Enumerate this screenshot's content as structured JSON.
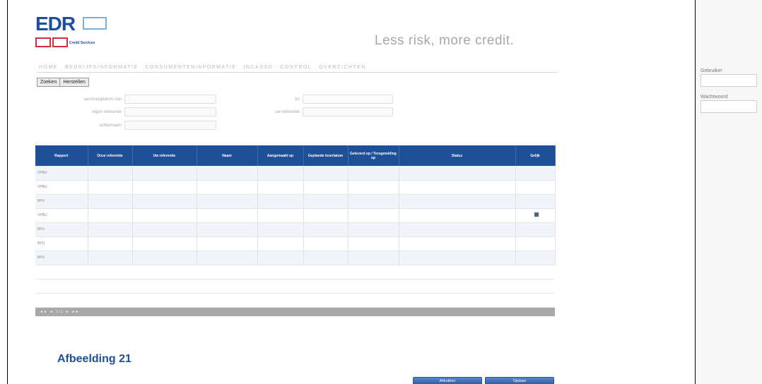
{
  "logo": {
    "text": "EDR",
    "subtitle": "Credit Services"
  },
  "tagline": "Less risk, more credit.",
  "nav": [
    "HOME",
    "BEDRIJFSINFORMATIE",
    "CONSUMENTENINFORMATIE",
    "INCASSO",
    "CONTROL",
    "OVERZICHTEN"
  ],
  "buttons": {
    "search": "Zoeken",
    "reset": "Herstellen"
  },
  "filters": {
    "left": [
      "aanvraagdatum van",
      "eigen referentie",
      "achternaam"
    ],
    "right": [
      "tot",
      "uw referentie"
    ]
  },
  "table": {
    "headers": [
      "Rapport",
      "Onze referentie",
      "Uw referentie",
      "Naam",
      "Aangemaakt op",
      "Geplande levertatum",
      "Geleverd op / Terugmelding op",
      "Status",
      "Gelijk"
    ],
    "rows": [
      [
        "VPBU",
        "",
        "",
        "",
        "",
        "",
        "",
        "",
        ""
      ],
      [
        "VPBU",
        "",
        "",
        "",
        "",
        "",
        "",
        "",
        ""
      ],
      [
        "BPU",
        "",
        "",
        "",
        "",
        "",
        "",
        "",
        ""
      ],
      [
        "VPBU",
        "",
        "",
        "",
        "",
        "",
        "",
        "",
        "pdf"
      ],
      [
        "BPU",
        "",
        "",
        "",
        "",
        "",
        "",
        "",
        ""
      ],
      [
        "BPU",
        "",
        "",
        "",
        "",
        "",
        "",
        "",
        ""
      ],
      [
        "BPU",
        "",
        "",
        "",
        "",
        "",
        "",
        "",
        ""
      ]
    ],
    "pager": [
      "◄◄",
      "◄",
      "1 / 1",
      "►",
      "►►"
    ]
  },
  "caption": "Afbeelding 21",
  "right_panel": {
    "field1": "Gebruiker",
    "field2": "Wachtwoord"
  },
  "bottom_buttons": [
    "Afdrukken",
    "Opslaan"
  ]
}
